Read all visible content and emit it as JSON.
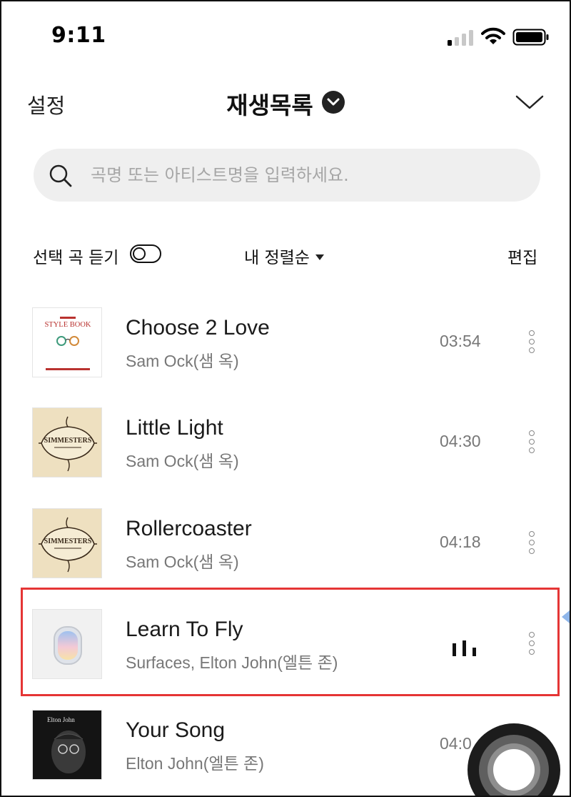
{
  "status_bar": {
    "time": "9:11",
    "icons": [
      "cellular-signal-icon",
      "wifi-icon",
      "battery-icon"
    ]
  },
  "header": {
    "settings_label": "설정",
    "title": "재생목록",
    "title_dropdown_icon": "chevron-down-circle-icon",
    "collapse_icon": "chevron-down-icon"
  },
  "search": {
    "icon": "search-icon",
    "placeholder": "곡명 또는 아티스트명을 입력하세요.",
    "value": ""
  },
  "options": {
    "select_play_label": "선택 곡 듣기",
    "select_play_toggle_on": false,
    "sort_label": "내 정렬순",
    "edit_label": "편집"
  },
  "tracks": [
    {
      "title": "Choose 2 Love",
      "artist": "Sam Ock(샘 옥)",
      "duration": "03:54",
      "art_text": "STYLE BOOK",
      "playing": false
    },
    {
      "title": "Little Light",
      "artist": "Sam Ock(샘 옥)",
      "duration": "04:30",
      "art_text": "SIMMESTERS",
      "playing": false
    },
    {
      "title": "Rollercoaster",
      "artist": "Sam Ock(샘 옥)",
      "duration": "04:18",
      "art_text": "SIMMESTERS",
      "playing": false
    },
    {
      "title": "Learn To Fly",
      "artist": "Surfaces, Elton John(엘튼 존)",
      "duration": "",
      "art_text": "",
      "playing": true
    },
    {
      "title": "Your Song",
      "artist": "Elton John(엘튼 존)",
      "duration": "04:0",
      "art_text": "Elton John",
      "playing": false
    }
  ],
  "colors": {
    "highlight_border": "#e53535",
    "search_bg": "#efefef",
    "accent_dark": "#222222"
  }
}
